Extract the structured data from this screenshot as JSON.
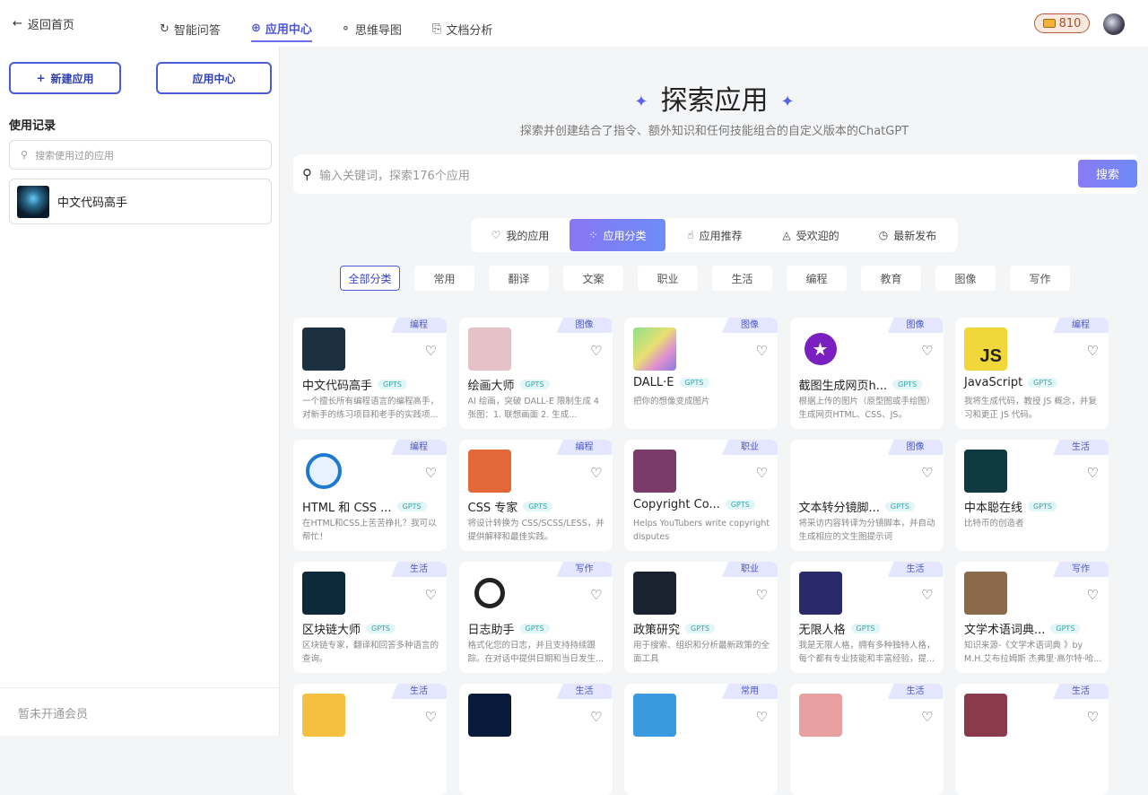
{
  "topbar": {
    "back_label": "返回首页",
    "tabs": [
      {
        "label": "智能问答"
      },
      {
        "label": "应用中心"
      },
      {
        "label": "思维导图"
      },
      {
        "label": "文档分析"
      }
    ],
    "coins": "810"
  },
  "sidebar": {
    "new_app": "新建应用",
    "app_center": "应用中心",
    "history_title": "使用记录",
    "history_search_placeholder": "搜索使用过的应用",
    "history_items": [
      {
        "name": "中文代码高手"
      }
    ],
    "footer": "暂未开通会员"
  },
  "main": {
    "title": "探索应用",
    "subtitle": "探索并创建结合了指令、额外知识和任何技能组合的自定义版本的ChatGPT",
    "search_placeholder": "输入关键词，探索176个应用",
    "search_button": "搜索",
    "segments": [
      {
        "label": "我的应用",
        "icon": "heart-icon"
      },
      {
        "label": "应用分类",
        "icon": "grid-icon"
      },
      {
        "label": "应用推荐",
        "icon": "thumb-up-icon"
      },
      {
        "label": "受欢迎的",
        "icon": "flame-icon"
      },
      {
        "label": "最新发布",
        "icon": "clock-icon"
      }
    ],
    "categories": [
      "全部分类",
      "常用",
      "翻译",
      "文案",
      "职业",
      "生活",
      "编程",
      "教育",
      "图像",
      "写作"
    ],
    "gpts_badge": "GPTS",
    "cards": [
      {
        "tag": "编程",
        "name": "中文代码高手",
        "desc": "一个擅长所有编程语言的编程高手，对新手的练习项目和老手的实践项...",
        "color": "#1b3040"
      },
      {
        "tag": "图像",
        "name": "绘画大师",
        "desc": "AI 绘画，突破 DALL-E 限制生成 4 张图：1. 联想画面 2. 生成...",
        "color": "#e6c2c8"
      },
      {
        "tag": "图像",
        "name": "DALL·E",
        "desc": "把你的想像变成图片",
        "color": "#9dd6a0"
      },
      {
        "tag": "图像",
        "name": "截图生成网页h...",
        "desc": "根据上传的图片（原型图或手绘图）生成网页HTML、CSS、JS。",
        "color": "#ffffff"
      },
      {
        "tag": "编程",
        "name": "JavaScript",
        "desc": "我将生成代码，教授 JS 概念，并复习和更正 JS 代码。",
        "color": "#f0d83a"
      },
      {
        "tag": "编程",
        "name": "HTML 和 CSS ...",
        "desc": "在HTML和CSS上苦苦挣扎？我可以帮忙！",
        "color": "#ffffff"
      },
      {
        "tag": "编程",
        "name": "CSS 专家",
        "desc": "将设计转换为 CSS/SCSS/LESS，并提供解释和最佳实践。",
        "color": "#e2683a"
      },
      {
        "tag": "职业",
        "name": "Copyright Co...",
        "desc": "Helps YouTubers write copyright disputes",
        "color": "#7a3a6a"
      },
      {
        "tag": "图像",
        "name": "文本转分镜脚...",
        "desc": "将采访内容转译为分镜脚本，并自动生成相应的文生图提示词",
        "color": "#ffffff"
      },
      {
        "tag": "生活",
        "name": "中本聪在线",
        "desc": "比特币的创造者",
        "color": "#0e3a40"
      },
      {
        "tag": "生活",
        "name": "区块链大师",
        "desc": "区块链专家，翻译和回答多种语言的查询。",
        "color": "#0d2a3a"
      },
      {
        "tag": "写作",
        "name": "日志助手",
        "desc": "格式化您的日志，并且支持持续跟踪。在对话中提供日期和当日发生...",
        "color": "#ffffff"
      },
      {
        "tag": "职业",
        "name": "政策研究",
        "desc": "用于搜索、组织和分析最新政策的全面工具",
        "color": "#1a2230"
      },
      {
        "tag": "生活",
        "name": "无限人格",
        "desc": "我是无限人格，拥有多种独特人格，每个都有专业技能和丰富经验，提...",
        "color": "#2a2a6a"
      },
      {
        "tag": "写作",
        "name": "文学术语词典...",
        "desc": "知识来源-《文学术语词典 》by M.H.艾布拉姆斯 杰弗里·高尔特·哈...",
        "color": "#8a6a4a"
      },
      {
        "tag": "生活",
        "name": "",
        "desc": "",
        "color": "#f5c040"
      },
      {
        "tag": "生活",
        "name": "",
        "desc": "",
        "color": "#0a1a3a"
      },
      {
        "tag": "常用",
        "name": "",
        "desc": "",
        "color": "#3a9ae0"
      },
      {
        "tag": "生活",
        "name": "",
        "desc": "",
        "color": "#e8a0a0"
      },
      {
        "tag": "生活",
        "name": "",
        "desc": "",
        "color": "#8a3a4a"
      }
    ]
  },
  "colors": {
    "accent": "#4a5bd8",
    "accent_gradient_start": "#8977f4",
    "accent_gradient_end": "#6d8cf6"
  }
}
